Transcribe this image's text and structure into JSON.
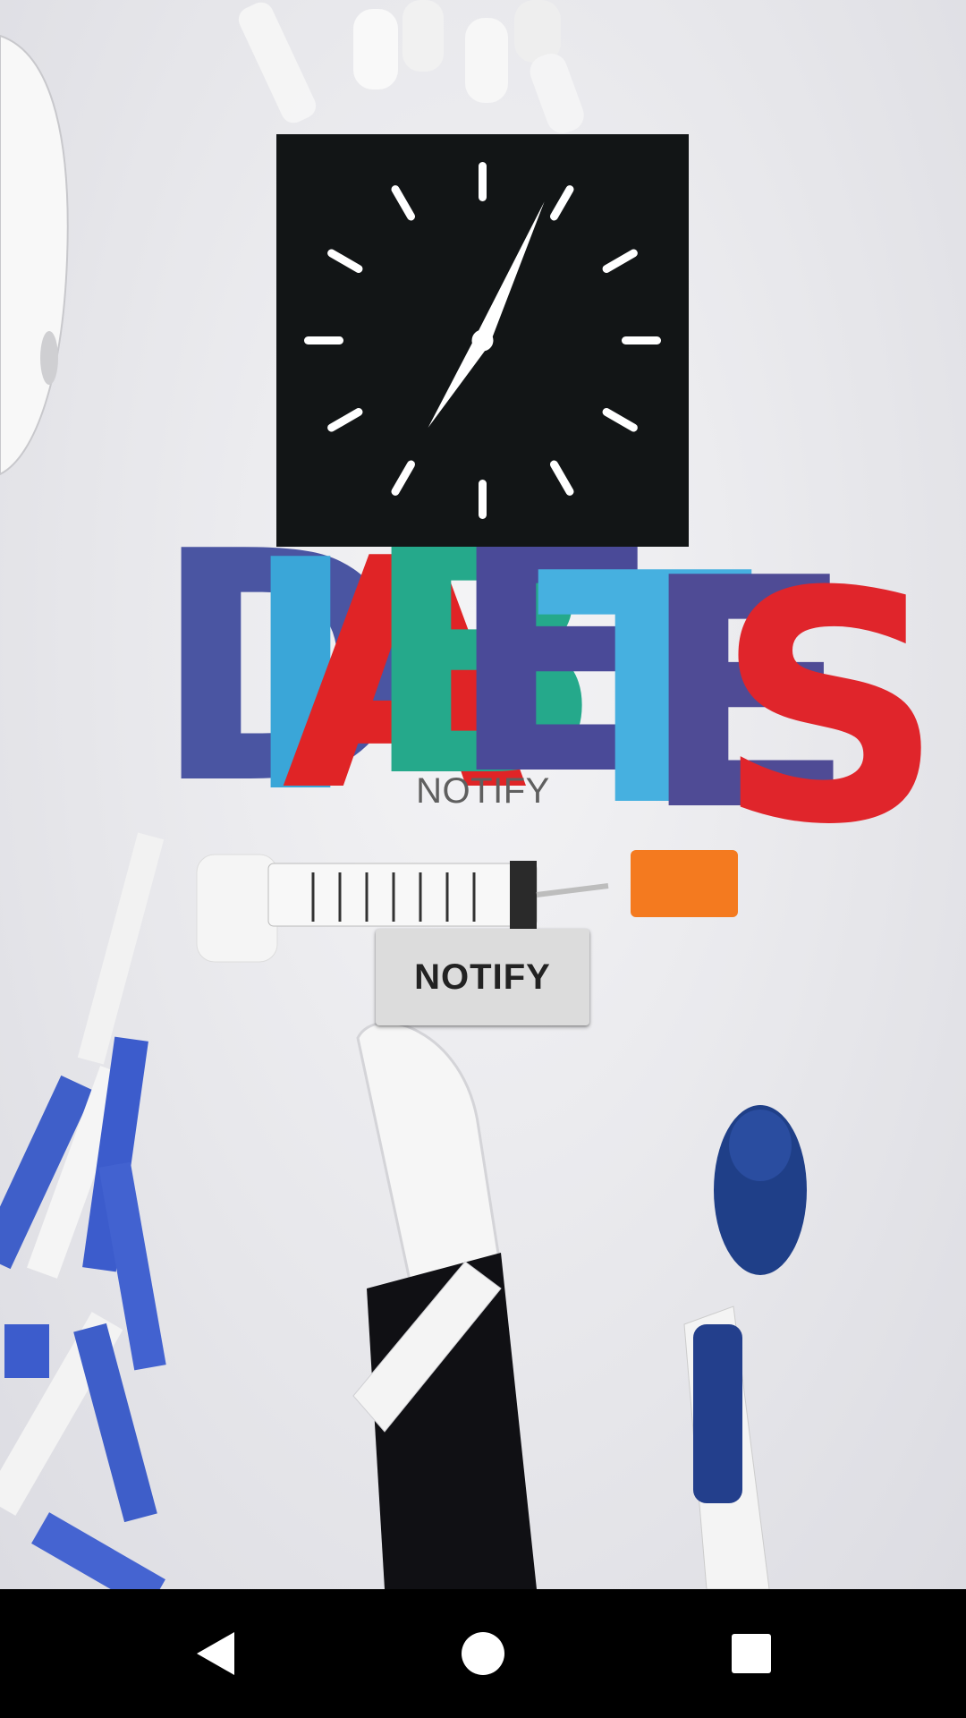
{
  "notify_text": "NOTIFY",
  "notify_button": {
    "label": "NOTIFY"
  },
  "background_art": {
    "letters": [
      {
        "char": "D",
        "color": "#4a55a2"
      },
      {
        "char": "I",
        "color": "#3aa6d8"
      },
      {
        "char": "A",
        "color": "#e02426"
      },
      {
        "char": "B",
        "color": "#25a98b"
      },
      {
        "char": "E",
        "color": "#4a4a98"
      },
      {
        "char": "T",
        "color": "#46b0e0"
      },
      {
        "char": "E",
        "color": "#4f4b95"
      },
      {
        "char": "S",
        "color": "#e0252b"
      }
    ]
  },
  "clock": {
    "hour": 7,
    "minute": 4
  },
  "navbar": {
    "icons": [
      "back-icon",
      "home-icon",
      "recent-apps-icon"
    ]
  },
  "colors": {
    "clock_face": "#121516",
    "button_bg": "#dcdcdc",
    "navbar": "#000000"
  }
}
